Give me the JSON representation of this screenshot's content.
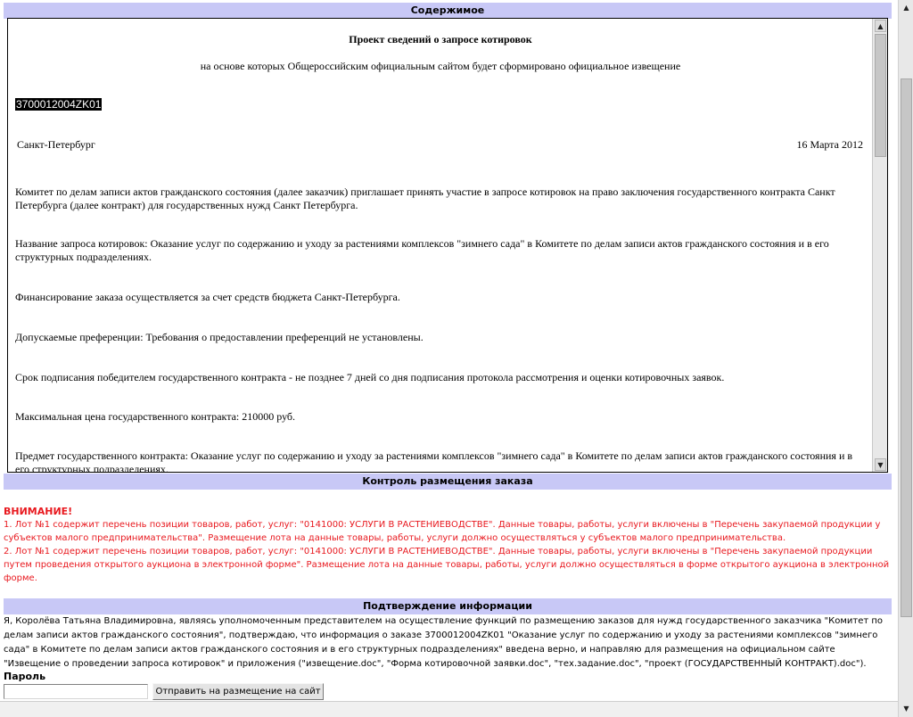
{
  "sections": {
    "content_title": "Содержимое",
    "control_title": "Контроль размещения заказа",
    "confirm_title": "Подтверждение информации"
  },
  "document": {
    "title": "Проект сведений о запросе котировок",
    "subtitle": "на основе которых Общероссийским официальным сайтом будет сформировано официальное извещение",
    "code": "3700012004ZK01",
    "city": "Санкт-Петербург",
    "date": "16 Марта 2012",
    "paragraphs": [
      "Комитет по делам записи актов гражданского состояния (далее заказчик) приглашает принять участие в запросе котировок на право заключения государственного контракта Санкт Петербурга (далее контракт) для государственных нужд Санкт Петербурга.",
      "Название запроса котировок: Оказание услуг по содержанию и уходу за растениями комплексов \"зимнего сада\" в Комитете по делам записи актов гражданского состояния и в его структурных подразделениях.",
      "Финансирование заказа осуществляется за счет средств бюджета Санкт-Петербурга.",
      "Допускаемые преференции: Требования о предоставлении преференций не установлены.",
      "Срок подписания победителем государственного контракта - не позднее 7 дней со дня подписания протокола рассмотрения и оценки котировочных заявок.",
      "Максимальная цена государственного контракта: 210000 руб.",
      "Предмет государственного контракта: Оказание услуг по содержанию и уходу за растениями комплексов \"зимнего сада\" в Комитете по делам записи актов гражданского состояния и в его структурных подразделениях."
    ]
  },
  "warning": {
    "heading": "ВНИМАНИЕ!",
    "items": [
      "1. Лот №1 содержит перечень позиции товаров, работ, услуг: \"0141000: УСЛУГИ В РАСТЕНИЕВОДСТВЕ\". Данные товары, работы, услуги включены в \"Перечень закупаемой продукции у субъектов малого предпринимательства\". Размещение лота на данные товары, работы, услуги должно осуществляться у субъектов малого предпринимательства.",
      "2. Лот №1 содержит перечень позиции товаров, работ, услуг: \"0141000: УСЛУГИ В РАСТЕНИЕВОДСТВЕ\". Данные товары, работы, услуги включены в \"Перечень закупаемой продукции путем проведения открытого аукциона в электронной форме\". Размещение лота на данные товары, работы, услуги должно осуществляться в форме открытого аукциона в электронной форме."
    ]
  },
  "confirm": {
    "text": "Я, Королёва Татьяна Владимировна, являясь уполномоченным представителем на осуществление функций по размещению заказов для нужд государственного заказчика \"Комитет по делам записи актов гражданского состояния\", подтверждаю, что информация о заказе 3700012004ZK01 \"Оказание услуг по содержанию и уходу за растениями комплексов \"зимнего сада\" в Комитете по делам записи актов гражданского состояния и в его структурных подразделениях\" введена верно, и направляю для размещения на официальном сайте \"Извещение о проведении запроса котировок\" и приложения (\"извещение.doc\", \"Форма котировочной заявки.doc\", \"тех.задание.doc\", \"проект (ГОСУДАРСТВЕННЫЙ КОНТРАКТ).doc\").",
    "password_label": "Пароль",
    "password_value": "",
    "submit_label": "Отправить на размещение на сайт"
  }
}
